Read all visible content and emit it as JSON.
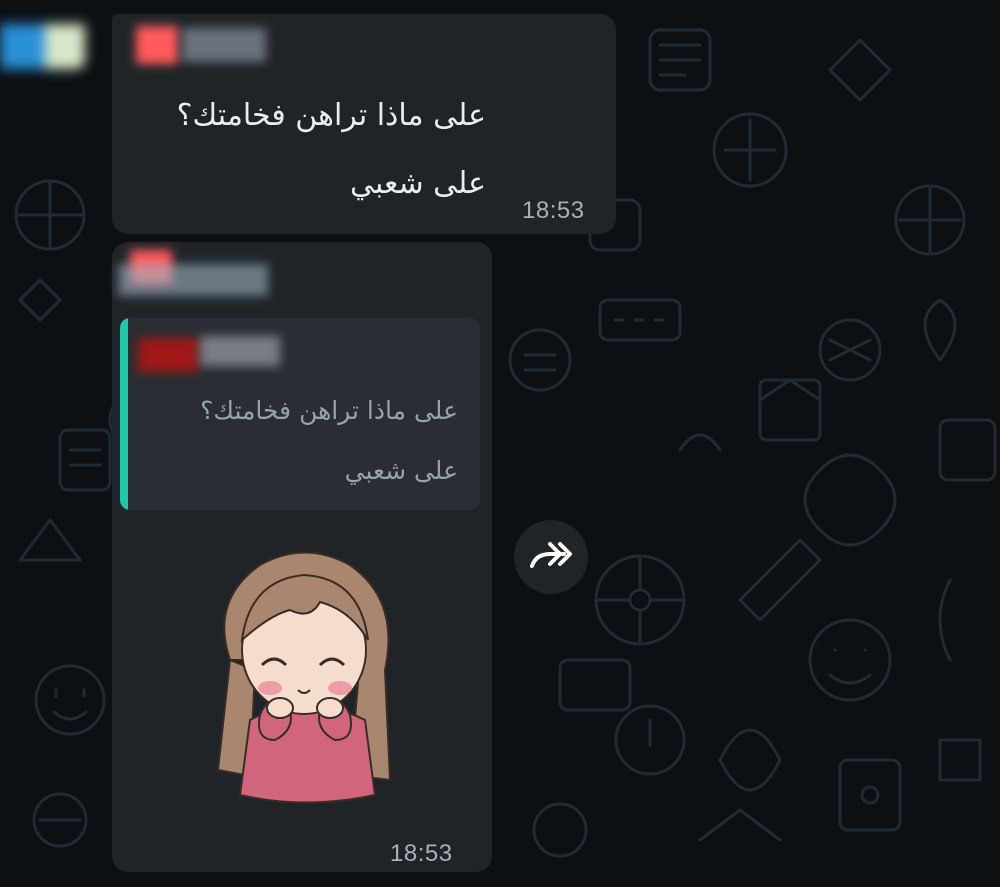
{
  "messages": [
    {
      "lines": [
        "على ماذا تراهن فخامتك؟",
        "على شعبي"
      ],
      "time": "18:53"
    },
    {
      "quoted": {
        "lines": [
          "على ماذا تراهن فخامتك؟",
          "على شعبي"
        ]
      },
      "sticker": "cute-girl-sticker",
      "time": "18:53"
    }
  ],
  "forward_icon": "forward-icon",
  "colors": {
    "background": "#0b1014",
    "bubble": "#1f2428",
    "quote_bar": "#21c7a8",
    "text": "#e9edef",
    "meta": "#a9b0b6"
  }
}
